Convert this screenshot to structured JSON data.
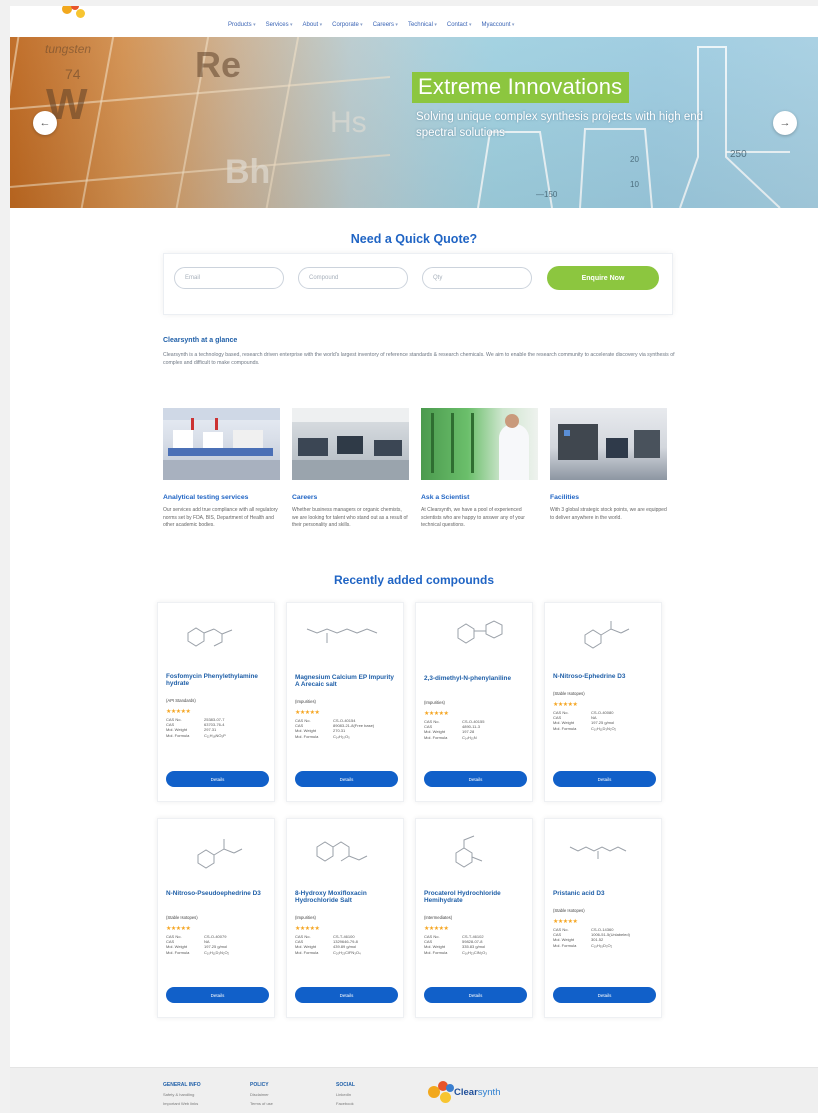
{
  "header": {
    "logo_small_text": "",
    "nav": [
      "Products",
      "Services",
      "About",
      "Corporate",
      "Careers",
      "Technical",
      "Contact",
      "Myaccount"
    ]
  },
  "hero": {
    "title": "Extreme Innovations",
    "subtitle": "Solving unique complex synthesis projects with high end spectral solutions",
    "prev_icon": "arrow-left-icon",
    "next_icon": "arrow-right-icon"
  },
  "quote": {
    "title": "Need a Quick Quote?",
    "email_placeholder": "Email",
    "compound_placeholder": "Compound",
    "qty_placeholder": "Qty",
    "button": "Enquire Now"
  },
  "glance": {
    "heading": "Clearsynth at a glance",
    "text": "Clearsynth is a technology based, research driven enterprise with the world's largest inventory of reference standards & research chemicals. We aim to enable the research community to accelerate discovery via synthesis of complex and difficult to make compounds."
  },
  "features": [
    {
      "title": "Analytical testing services",
      "text": "Our services add true compliance with all regulatory norms set by FDA, BIS, Department of Health and other academic bodies."
    },
    {
      "title": "Careers",
      "text": "Whether business managers or organic chemists, we are looking for talent who stand out as a result of their personality and skills."
    },
    {
      "title": "Ask a Scientist",
      "text": "At Clearsynth, we have a pool of experienced scientists who are happy to answer any of your technical questions."
    },
    {
      "title": "Facilities",
      "text": "With 3 global strategic stock points, we are equipped to deliver anywhere in the world."
    }
  ],
  "recent": {
    "title": "Recently added compounds",
    "cards": [
      {
        "name": "Fosfomycin Phenylethylamine hydrate",
        "cat": "(API Standards)",
        "stars": "★★★★★",
        "props": [
          [
            "CAS No.",
            "25383-07-7"
          ],
          [
            "CAS",
            "63703-76-4"
          ],
          [
            "Mol. Weight",
            "297.31"
          ],
          [
            "Mol. Formula",
            "C₁₁H₁₈NO₅P"
          ]
        ],
        "button": "Details"
      },
      {
        "name": "Magnesium Calcium EP Impurity A Arecaic salt",
        "cat": "(Impurities)",
        "stars": "★★★★★",
        "props": [
          [
            "CAS No.",
            "CS-O-40154"
          ],
          [
            "CAS",
            "89083-21-8(Free base)"
          ],
          [
            "Mol. Weight",
            "270.31"
          ],
          [
            "Mol. Formula",
            "C₁₄H₂₀O₅"
          ]
        ],
        "button": "Details"
      },
      {
        "name": "2,3-dimethyl-N-phenylaniline",
        "cat": "(Impurities)",
        "stars": "★★★★★",
        "props": [
          [
            "CAS No.",
            "CS-O-40155"
          ],
          [
            "CAS",
            "4890-11-3"
          ],
          [
            "Mol. Weight",
            "197.28"
          ],
          [
            "Mol. Formula",
            "C₁₄H₁₅N"
          ]
        ],
        "button": "Details"
      },
      {
        "name": "N-Nitroso-Ephedrine D3",
        "cat": "(Stable Isotopes)",
        "stars": "★★★★★",
        "props": [
          [
            "CAS No.",
            "CS-O-40080"
          ],
          [
            "CAS",
            "NA"
          ],
          [
            "Mol. Weight",
            "197.25 g/mol"
          ],
          [
            "Mol. Formula",
            "C₁₀H₁₁D₃N₂O₂"
          ]
        ],
        "button": "Details"
      },
      {
        "name": "N-Nitroso-Pseudoephedrine D3",
        "cat": "(Stable Isotopes)",
        "stars": "★★★★★",
        "props": [
          [
            "CAS No.",
            "CS-O-40079"
          ],
          [
            "CAS",
            "NA"
          ],
          [
            "Mol. Weight",
            "197.25 g/mol"
          ],
          [
            "Mol. Formula",
            "C₁₀H₁₁D₃N₂O₂"
          ]
        ],
        "button": "Details"
      },
      {
        "name": "8-Hydroxy Moxifloxacin Hydrochloride Salt",
        "cat": "(Impurities)",
        "stars": "★★★★★",
        "props": [
          [
            "CAS No.",
            "CS-T-46100"
          ],
          [
            "CAS",
            "1329646-79-8"
          ],
          [
            "Mol. Weight",
            "439.89 g/mol"
          ],
          [
            "Mol. Formula",
            "C₂₀H₂₃ClFN₃O₄"
          ]
        ],
        "button": "Details"
      },
      {
        "name": "Procaterol Hydrochloride Hemihydrate",
        "cat": "(Intermediates)",
        "stars": "★★★★★",
        "props": [
          [
            "CAS No.",
            "CS-T-46102"
          ],
          [
            "CAS",
            "59828-07-8"
          ],
          [
            "Mol. Weight",
            "335.83 g/mol"
          ],
          [
            "Mol. Formula",
            "C₁₆H₂₃ClN₂O₃"
          ]
        ],
        "button": "Details"
      },
      {
        "name": "Pristanic acid D3",
        "cat": "(Stable Isotopes)",
        "stars": "★★★★★",
        "props": [
          [
            "CAS No.",
            "CS-O-14360"
          ],
          [
            "CAS",
            "1006-51-5(Unlabeled)"
          ],
          [
            "Mol. Weight",
            "301.52"
          ],
          [
            "Mol. Formula",
            "C₁₉H₃₅D₃O₂"
          ]
        ],
        "button": "Details"
      }
    ]
  },
  "footer": {
    "col1": {
      "title": "GENERAL INFO",
      "items": [
        "Safety & handling",
        "Important Web links"
      ]
    },
    "col2": {
      "title": "POLICY",
      "items": [
        "Disclaimer",
        "Terms of use"
      ]
    },
    "col3": {
      "title": "SOCIAL",
      "items": [
        "LinkedIn",
        "Facebook"
      ]
    },
    "brand": "Clear",
    "brand2": "synth"
  },
  "colors": {
    "accent_green": "#8cc63f",
    "brand_blue": "#1f64c4",
    "button_blue": "#1160c9"
  }
}
